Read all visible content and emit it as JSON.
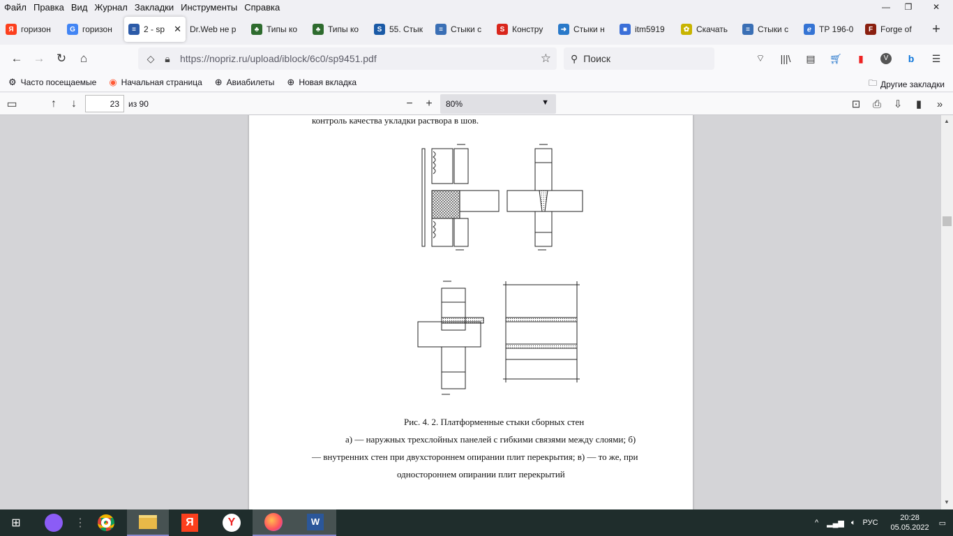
{
  "menu": [
    "Файл",
    "Правка",
    "Вид",
    "Журнал",
    "Закладки",
    "Инструменты",
    "Справка"
  ],
  "tabs": [
    {
      "label": "горизон",
      "icon": "yandex-icon",
      "color": "#fc3f1d",
      "glyph": "Я"
    },
    {
      "label": "горизон",
      "icon": "google-icon",
      "color": "#4285f4",
      "glyph": "G"
    },
    {
      "label": "2 - sp",
      "icon": "pdf-site-icon",
      "color": "#2b5aa8",
      "glyph": "≡",
      "active": true
    },
    {
      "label": "Dr.Web не р",
      "icon": "none",
      "color": "",
      "glyph": ""
    },
    {
      "label": "Типы ко",
      "icon": "tree-icon",
      "color": "#2e6b2e",
      "glyph": "♣"
    },
    {
      "label": "Типы ко",
      "icon": "tree-icon",
      "color": "#2e6b2e",
      "glyph": "♣"
    },
    {
      "label": "55. Стык",
      "icon": "s-icon",
      "color": "#1a5aa6",
      "glyph": "S"
    },
    {
      "label": "Стыки с",
      "icon": "list-icon",
      "color": "#3a6fb5",
      "glyph": "≡"
    },
    {
      "label": "Констру",
      "icon": "s-red-icon",
      "color": "#d9261c",
      "glyph": "S"
    },
    {
      "label": "Стыки н",
      "icon": "arrow-icon",
      "color": "#2979c9",
      "glyph": "➜"
    },
    {
      "label": "itm5919",
      "icon": "cube-icon",
      "color": "#3b6fd8",
      "glyph": "■"
    },
    {
      "label": "Скачать",
      "icon": "gear-icon",
      "color": "#c8b400",
      "glyph": "✿"
    },
    {
      "label": "Стыки с",
      "icon": "list-icon",
      "color": "#3a6fb5",
      "glyph": "≡"
    },
    {
      "label": "ТР 196-0",
      "icon": "swirl-icon",
      "color": "#3574d4",
      "glyph": "ℯ"
    },
    {
      "label": "Forge of",
      "icon": "forge-icon",
      "color": "#8a1f0f",
      "glyph": "F"
    }
  ],
  "url": "https://nopriz.ru/upload/iblock/6c0/sp9451.pdf",
  "search_placeholder": "Поиск",
  "bookmarks": [
    {
      "label": "Часто посещаемые",
      "icon": "gear-icon"
    },
    {
      "label": "Начальная страница",
      "icon": "firefox-icon"
    },
    {
      "label": "Авиабилеты",
      "icon": "globe-icon"
    },
    {
      "label": "Новая вкладка",
      "icon": "globe-icon"
    }
  ],
  "other_bookmarks": "Другие закладки",
  "pdf": {
    "page": "23",
    "page_count": "из 90",
    "zoom": "80%"
  },
  "document": {
    "top_line": "контроль качества укладки раствора в шов.",
    "caption_title": "Рис. 4. 2. Платформенные стыки сборных стен",
    "caption_line1": "а) — наружных трехслойных панелей с гибкими связями между слоями; б)",
    "caption_line2": "— внутренних стен при двухстороннем опирании плит перекрытия; в) — то же, при",
    "caption_line3": "одностороннем опирании плит перекрытий"
  },
  "tray": {
    "lang": "РУС",
    "time": "20:28",
    "date": "05.05.2022"
  }
}
